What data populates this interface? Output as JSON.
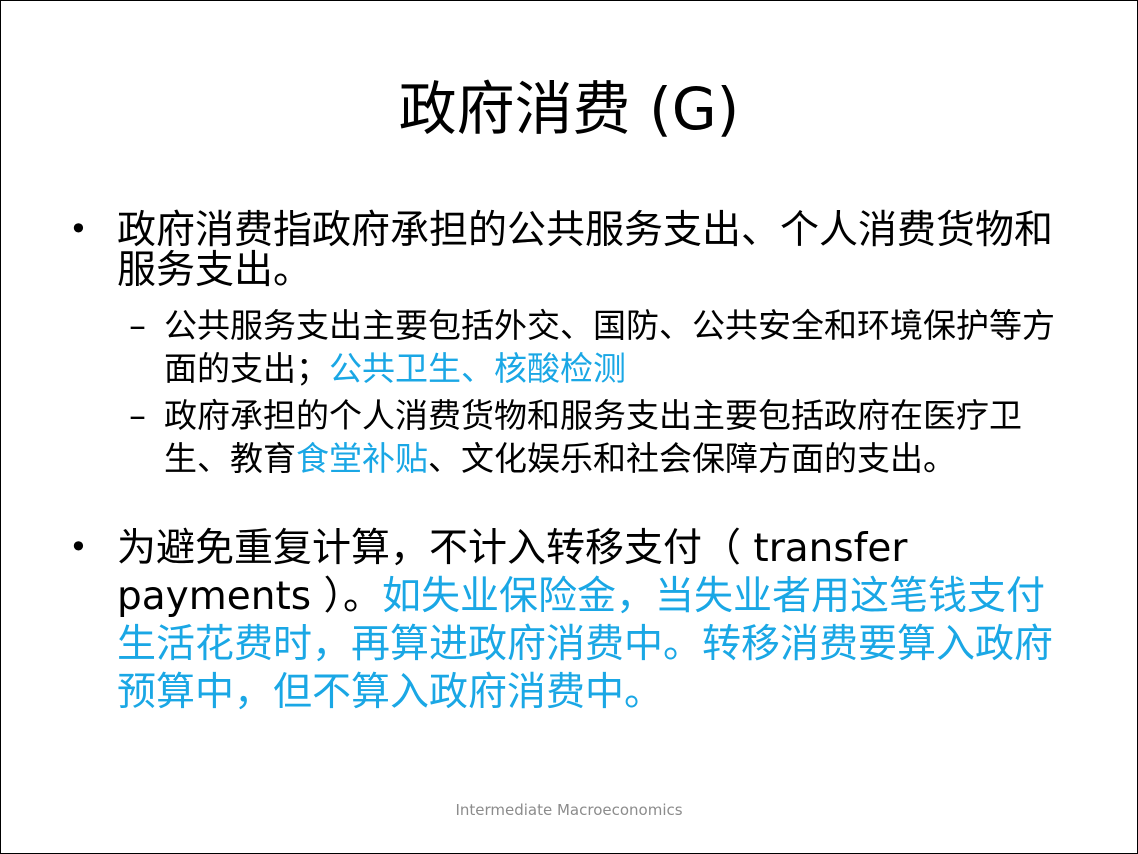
{
  "slide": {
    "title": "政府消费 (G)",
    "footer": "Intermediate Macroeconomics",
    "colors": {
      "text": "#000000",
      "highlight": "#1aa7e5",
      "footer": "#8c8c8c"
    },
    "bullets": [
      {
        "text": "政府消费指政府承担的公共服务支出、个人消费货物和服务支出。",
        "sub": [
          {
            "text": "公共服务支出主要包括外交、国防、公共安全和环境保护等方面的支出；",
            "highlight": "公共卫生、核酸检测"
          },
          {
            "text_before": "政府承担的个人消费货物和服务支出主要包括政府在医疗卫生、教育",
            "highlight": "食堂补贴",
            "text_after": "、文化娱乐和社会保障方面的支出。"
          }
        ]
      },
      {
        "text": "为避免重复计算，不计入转移支付（ transfer payments ）。",
        "note": "如失业保险金，当失业者用这笔钱支付生活花费时，再算进政府消费中。转移消费要算入政府预算中，但不算入政府消费中。"
      }
    ],
    "markers": {
      "bullet": "•",
      "dash": "–"
    }
  }
}
